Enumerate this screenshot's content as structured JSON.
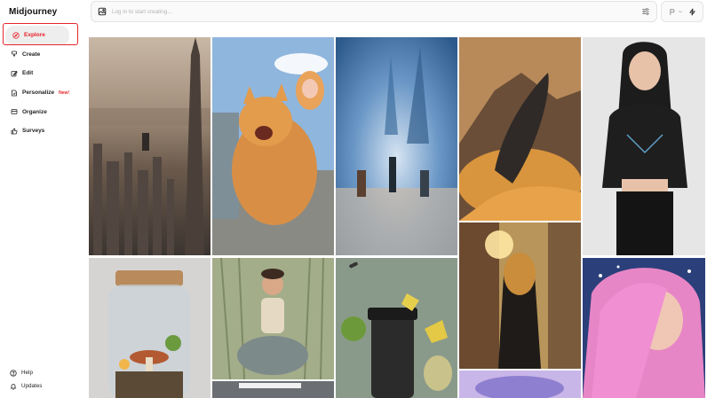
{
  "app": {
    "brand": "Midjourney"
  },
  "sidebar": {
    "items": [
      {
        "label": "Explore",
        "icon": "compass-icon",
        "active": true
      },
      {
        "label": "Create",
        "icon": "brush-icon"
      },
      {
        "label": "Edit",
        "icon": "pencil-icon"
      },
      {
        "label": "Personalize",
        "icon": "personalize-icon",
        "badge": "New!"
      },
      {
        "label": "Organize",
        "icon": "folder-icon"
      },
      {
        "label": "Surveys",
        "icon": "thumbs-up-icon"
      }
    ],
    "bottom": [
      {
        "label": "Help",
        "icon": "help-icon"
      },
      {
        "label": "Updates",
        "icon": "bell-icon"
      }
    ]
  },
  "prompt": {
    "placeholder": "Log in to start creating..."
  },
  "colors": {
    "accent": "#e7232a",
    "highlight_box": "#e4262c",
    "sidebar_active_bg": "#eeeeee"
  },
  "gallery": {
    "tiles": [
      {
        "name": "city-skyscraper-image"
      },
      {
        "name": "giant-cat-image"
      },
      {
        "name": "motion-blur-city-image"
      },
      {
        "name": "whale-desert-image"
      },
      {
        "name": "woman-black-outfit-image"
      },
      {
        "name": "terrarium-jar-image"
      },
      {
        "name": "child-rider-image"
      },
      {
        "name": "product-bottle-image"
      },
      {
        "name": "woman-street-sunset-image"
      },
      {
        "name": "pink-hair-illustration-image"
      },
      {
        "name": "partial-bottom-image"
      },
      {
        "name": "partial-bottom-image-2"
      }
    ]
  }
}
